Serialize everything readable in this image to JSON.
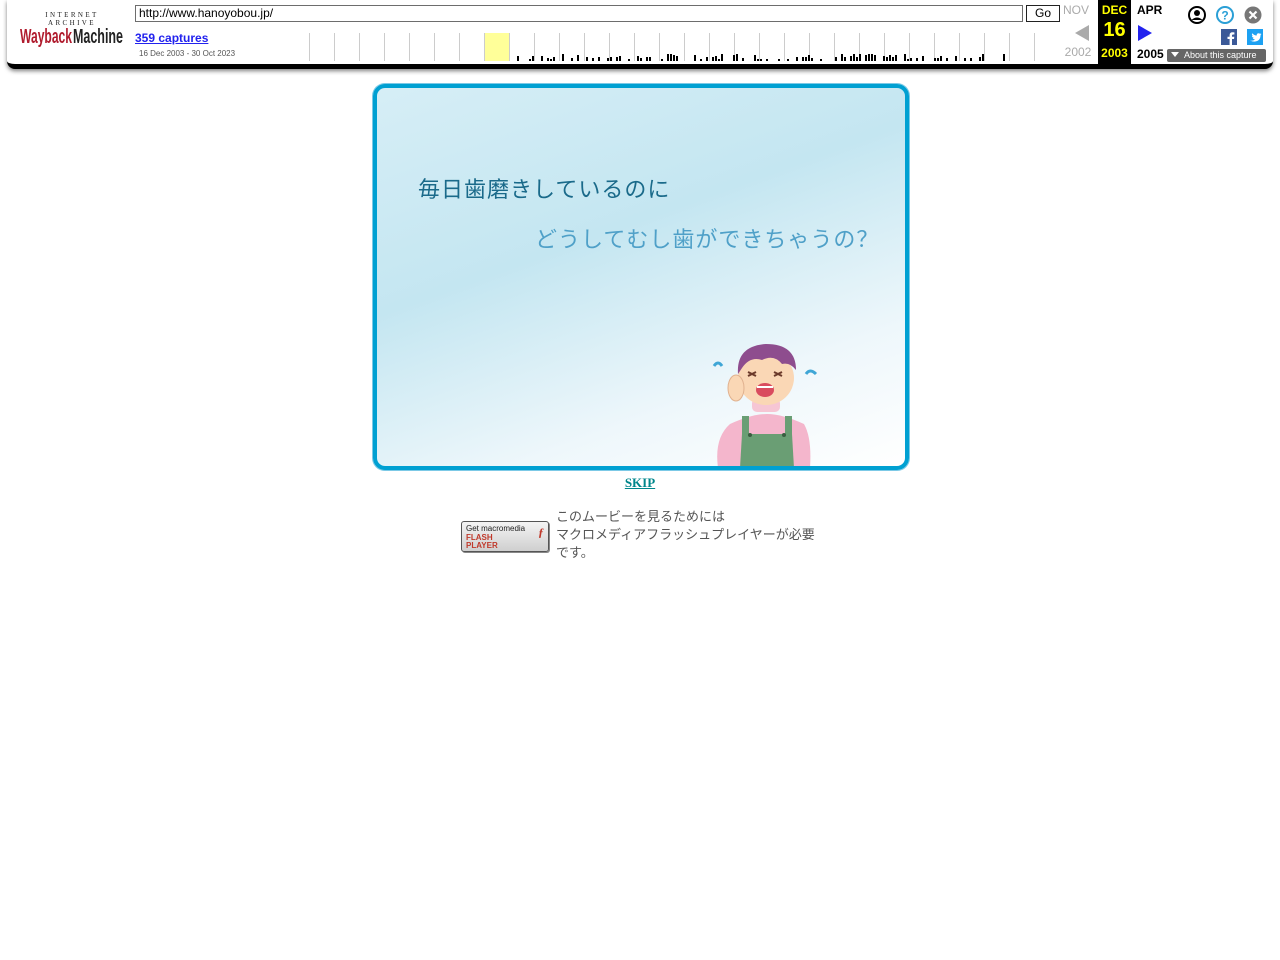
{
  "toolbar": {
    "logo_top": "INTERNET ARCHIVE",
    "logo_main": "WaybackMachine",
    "url": "http://www.hanoyobou.jp/",
    "go_label": "Go",
    "captures_label": "359 captures",
    "date_range": "16 Dec 2003 - 30 Oct 2023",
    "prev_month": "NOV",
    "prev_year": "2002",
    "current_month": "DEC",
    "current_day": "16",
    "current_year": "2003",
    "next_month": "APR",
    "next_year": "2005",
    "about_capture": "About this capture",
    "icons": {
      "user": "user-account-icon",
      "help": "help-question-icon",
      "close": "close-icon",
      "facebook": "facebook-icon",
      "twitter": "twitter-icon"
    },
    "colors": {
      "current_bg": "#000000",
      "current_text": "#ffff00",
      "link": "#2222ee",
      "highlight_year": "#ffff99"
    }
  },
  "content": {
    "headline1": "毎日歯磨きしているのに",
    "headline2": "どうしてむし歯ができちゃうの？",
    "skip_label": "SKIP",
    "flash_badge": {
      "line1": "Get macromedia",
      "line2": "FLASH",
      "line3": "PLAYER"
    },
    "flash_message": [
      "このムービーを見るためには",
      "マクロメディアフラッシュプレイヤーが必要",
      "です。"
    ],
    "colors": {
      "stage_border": "#00a0d2",
      "headline1": "#1a6a8a",
      "headline2": "#4fa0c8",
      "skip": "#00868b"
    }
  }
}
